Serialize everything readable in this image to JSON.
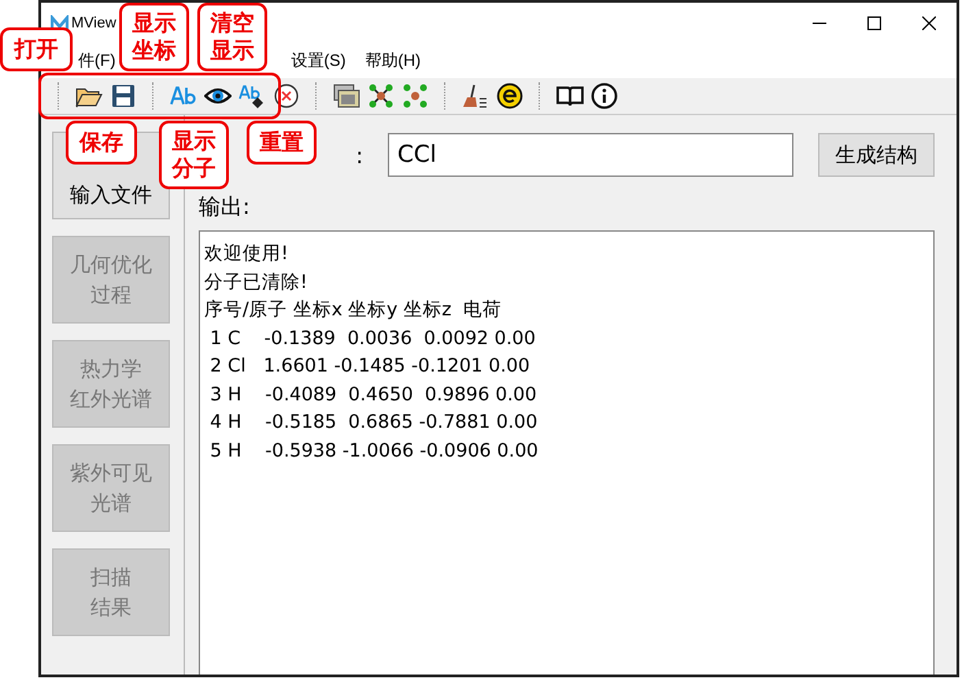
{
  "window": {
    "title": "MView"
  },
  "menu": [
    "件(F)",
    "设置(S)",
    "帮助(H)"
  ],
  "sidebar": [
    {
      "lines": [
        "输入文件"
      ],
      "disabled": false
    },
    {
      "lines": [
        "几何优化",
        "过程"
      ],
      "disabled": true
    },
    {
      "lines": [
        "热力学",
        "红外光谱"
      ],
      "disabled": true
    },
    {
      "lines": [
        "紫外可见",
        "光谱"
      ],
      "disabled": true
    },
    {
      "lines": [
        "扫描",
        "结果"
      ],
      "disabled": true
    }
  ],
  "input": {
    "label": ":",
    "value": "CCl"
  },
  "generate_button": "生成结构",
  "output": {
    "label": "输出:",
    "lines": [
      "欢迎使用!",
      "分子已清除!",
      "序号/原子 坐标x 坐标y 坐标z  电荷",
      " 1 C    -0.1389  0.0036  0.0092 0.00",
      " 2 Cl   1.6601 -0.1485 -0.1201 0.00",
      " 3 H    -0.4089  0.4650  0.9896 0.00",
      " 4 H    -0.5185  0.6865 -0.7881 0.00",
      " 5 H    -0.5938 -1.0066 -0.0906 0.00"
    ]
  },
  "callouts": [
    [
      "打开"
    ],
    [
      "显示",
      "坐标"
    ],
    [
      "清空",
      "显示"
    ],
    [
      "保存"
    ],
    [
      "显示",
      "分子"
    ],
    [
      "重置"
    ]
  ]
}
